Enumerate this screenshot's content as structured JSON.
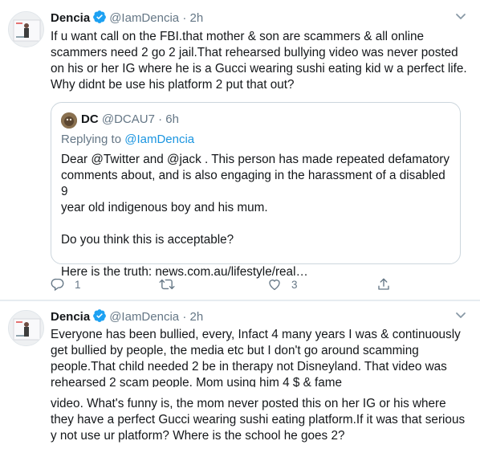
{
  "tweets": [
    {
      "author": "Dencia",
      "handle": "@IamDencia",
      "time": "2h",
      "text": "If u want call on the FBI.that mother & son are scammers & all online\nscammers need 2 go 2 jail.That rehearsed bullying video was never posted\non his or her IG where he is a Gucci wearing sushi eating kid w a perfect life.\nWhy didnt be use his platform 2 put that out?",
      "quote": {
        "author": "DC",
        "handle": "@DCAU7",
        "time": "6h",
        "replying_prefix": "Replying to",
        "replying_to": "@IamDencia",
        "text": "Dear @Twitter and @jack . This person has made repeated defamatory\ncomments about, and is also engaging in the harassment of a disabled 9\nyear old indigenous boy and his mum.\n\nDo you think this is acceptable?\n\nHere is the truth:  news.com.au/lifestyle/real…"
      },
      "actions": {
        "reply_count": "1",
        "retweet_count": "",
        "like_count": "3"
      }
    },
    {
      "author": "Dencia",
      "handle": "@IamDencia",
      "time": "2h",
      "text": "Everyone has been bullied, every, Infact 4 many years I was & continuously\nget bullied by people, the media etc but I don't go around scamming\npeople.That child needed 2 be in therapy not Disneyland. That video was\nrehearsed 2 scam people. Mom using him 4 $ & fame",
      "continuation": "video. What's funny is, the mom never posted this on her IG or his where\nthey have a perfect Gucci wearing sushi eating platform.If it was that serious\ny not use ur platform? Where is the school he goes 2?"
    }
  ],
  "separator": "·",
  "colors": {
    "verified": "#1da1f2",
    "secondary_text": "#657786",
    "link": "#1b95e0",
    "border": "#e6ecf0"
  },
  "icons": [
    "verified-badge-icon",
    "chevron-down-icon",
    "reply-icon",
    "retweet-icon",
    "like-icon",
    "share-icon"
  ]
}
